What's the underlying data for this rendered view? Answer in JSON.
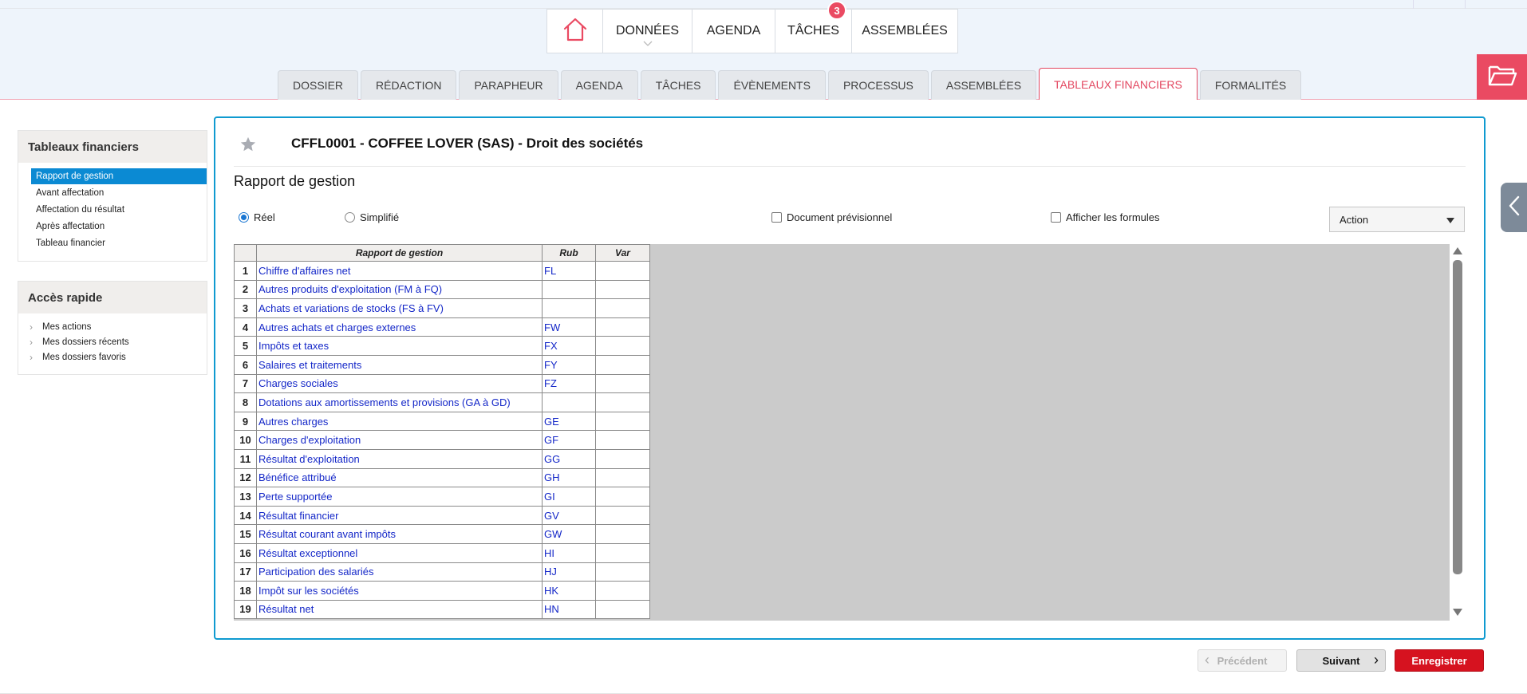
{
  "main_nav": {
    "items": [
      {
        "label": "DONNÉES"
      },
      {
        "label": "AGENDA"
      },
      {
        "label": "TÂCHES"
      },
      {
        "label": "ASSEMBLÉES"
      }
    ],
    "badge": "3"
  },
  "sub_tabs": [
    {
      "label": "DOSSIER"
    },
    {
      "label": "RÉDACTION"
    },
    {
      "label": "PARAPHEUR"
    },
    {
      "label": "AGENDA"
    },
    {
      "label": "TÂCHES"
    },
    {
      "label": "ÉVÈNEMENTS"
    },
    {
      "label": "PROCESSUS"
    },
    {
      "label": "ASSEMBLÉES"
    },
    {
      "label": "TABLEAUX FINANCIERS",
      "active": true
    },
    {
      "label": "FORMALITÉS"
    }
  ],
  "sidebar": {
    "tableaux": {
      "title": "Tableaux financiers",
      "items": [
        {
          "label": "Rapport de gestion",
          "active": true
        },
        {
          "label": "Avant affectation"
        },
        {
          "label": "Affectation du résultat"
        },
        {
          "label": "Après affectation"
        },
        {
          "label": "Tableau financier"
        }
      ]
    },
    "acces_rapide": {
      "title": "Accès rapide",
      "items": [
        {
          "label": "Mes actions"
        },
        {
          "label": "Mes dossiers récents"
        },
        {
          "label": "Mes dossiers favoris"
        }
      ]
    }
  },
  "main": {
    "dossier_title": "CFFL0001 - COFFEE LOVER (SAS) - Droit des sociétés",
    "section_title": "Rapport de gestion",
    "options": {
      "reel": "Réel",
      "simplifie": "Simplifié",
      "doc_prev": "Document prévisionnel",
      "afficher_formules": "Afficher les formules"
    },
    "action_label": "Action",
    "table": {
      "headers": [
        "Rapport de gestion",
        "Rub",
        "Var"
      ],
      "rows": [
        {
          "num": "1",
          "label": "Chiffre d'affaires net",
          "rub": "FL"
        },
        {
          "num": "2",
          "label": "Autres produits d'exploitation (FM à FQ)",
          "rub": ""
        },
        {
          "num": "3",
          "label": "Achats et variations de stocks (FS à FV)",
          "rub": ""
        },
        {
          "num": "4",
          "label": "Autres achats et charges externes",
          "rub": "FW"
        },
        {
          "num": "5",
          "label": "Impôts et taxes",
          "rub": "FX"
        },
        {
          "num": "6",
          "label": "Salaires et traitements",
          "rub": "FY"
        },
        {
          "num": "7",
          "label": "Charges sociales",
          "rub": "FZ"
        },
        {
          "num": "8",
          "label": "Dotations aux amortissements et provisions (GA à GD)",
          "rub": ""
        },
        {
          "num": "9",
          "label": "Autres charges",
          "rub": "GE"
        },
        {
          "num": "10",
          "label": "Charges d'exploitation",
          "rub": "GF"
        },
        {
          "num": "11",
          "label": "Résultat d'exploitation",
          "rub": "GG"
        },
        {
          "num": "12",
          "label": "Bénéfice attribué",
          "rub": "GH"
        },
        {
          "num": "13",
          "label": "Perte supportée",
          "rub": "GI"
        },
        {
          "num": "14",
          "label": "Résultat financier",
          "rub": "GV"
        },
        {
          "num": "15",
          "label": "Résultat courant avant impôts",
          "rub": "GW"
        },
        {
          "num": "16",
          "label": "Résultat exceptionnel",
          "rub": "HI"
        },
        {
          "num": "17",
          "label": "Participation des salariés",
          "rub": "HJ"
        },
        {
          "num": "18",
          "label": "Impôt sur les sociétés",
          "rub": "HK"
        },
        {
          "num": "19",
          "label": "Résultat net",
          "rub": "HN"
        }
      ]
    }
  },
  "footer": {
    "prev": "Précédent",
    "next": "Suivant",
    "save": "Enregistrer"
  },
  "colors": {
    "accent": "#ea4a62",
    "panel_border": "#0f9ad0",
    "link": "#1427c8",
    "save": "#d6121f"
  },
  "icons": [
    "home-icon",
    "chevron-down-icon",
    "folder-open-icon",
    "star-icon",
    "chevron-left-icon",
    "dropdown-arrow-icon"
  ]
}
